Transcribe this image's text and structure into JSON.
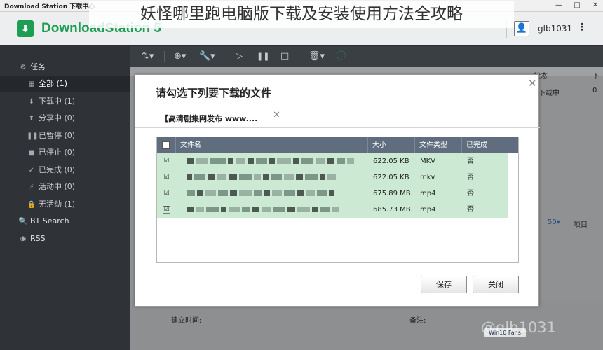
{
  "window": {
    "title": "Download Station 下载中心",
    "controls": [
      "—",
      "□",
      "✕"
    ]
  },
  "overlay_title": "妖怪哪里跑电脑版下载及安装使用方法全攻略",
  "app": {
    "logo_icon": "download-arrow-icon",
    "name": "DownloadStation 5",
    "accent_color": "#1f9d55",
    "user": "glb1031",
    "avatar_glyph": "👤",
    "menu_glyph": "⋮"
  },
  "sidebar": {
    "tasks_header": {
      "icon": "⚙",
      "label": "任务"
    },
    "items": [
      {
        "icon": "▦",
        "label": "全部 (1)"
      },
      {
        "icon": "⬇",
        "label": "下载中 (1)"
      },
      {
        "icon": "⬆",
        "label": "分享中 (0)"
      },
      {
        "icon": "❚❚",
        "label": "已暂停 (0)"
      },
      {
        "icon": "■",
        "label": "已停止 (0)"
      },
      {
        "icon": "✓",
        "label": "已完成 (0)"
      },
      {
        "icon": "⚡",
        "label": "活动中 (0)"
      },
      {
        "icon": "🔒",
        "label": "无活动 (1)"
      }
    ],
    "bt_search": {
      "icon": "🔍",
      "label": "BT Search"
    },
    "rss": {
      "icon": "◉",
      "label": "RSS"
    }
  },
  "toolbar": {
    "sort": "⇅▾",
    "add": "⊕▾",
    "tools": "🔧▾",
    "play": "▷",
    "pause": "❚❚",
    "stop": "□",
    "delete": "🗑▾",
    "info": "ⓘ"
  },
  "background": {
    "status_header": "状态",
    "status_value": "下载中",
    "col_partial": "下",
    "col_value": "0",
    "page_size": "50▾",
    "items_label": "项目",
    "create_time_label": "建立时间:",
    "note_label": "备注:"
  },
  "modal": {
    "title": "请勾选下列要下载的文件",
    "close": "✕",
    "tab": {
      "label": "【高清剧集网发布 www....",
      "close": "✕"
    },
    "table": {
      "headers": {
        "select": "☐",
        "name": "文件名",
        "size": "大小",
        "type": "文件类型",
        "done": "已完成"
      },
      "rows": [
        {
          "checked": "☑",
          "size": "622.05 KB",
          "type": "MKV",
          "done": "否"
        },
        {
          "checked": "☑",
          "size": "622.05 KB",
          "type": "mkv",
          "done": "否"
        },
        {
          "checked": "☑",
          "size": "675.89 MB",
          "type": "mp4",
          "done": "否"
        },
        {
          "checked": "☑",
          "size": "685.73 MB",
          "type": "mp4",
          "done": "否"
        }
      ]
    },
    "buttons": {
      "save": "保存",
      "close": "关闭"
    }
  },
  "watermark": {
    "text": "@glb1031",
    "badge": "Win10 Fans"
  }
}
